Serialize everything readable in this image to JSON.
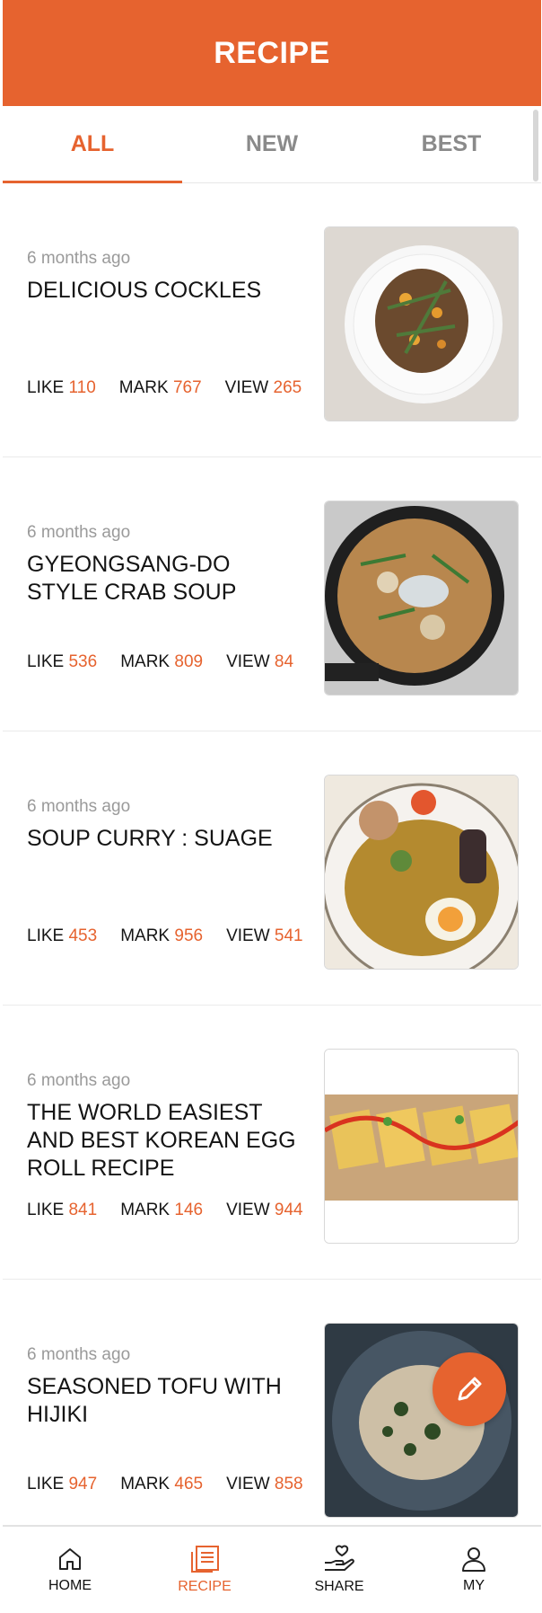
{
  "header": {
    "title": "RECIPE"
  },
  "tabs": [
    {
      "label": "ALL",
      "active": true
    },
    {
      "label": "NEW",
      "active": false
    },
    {
      "label": "BEST",
      "active": false
    }
  ],
  "stat_labels": {
    "like": "LIKE",
    "mark": "MARK",
    "view": "VIEW"
  },
  "recipes": [
    {
      "time": "6 months ago",
      "title": "DELICIOUS COCKLES",
      "like": "110",
      "mark": "767",
      "view": "265",
      "image": "cockles-dish-photo"
    },
    {
      "time": "6 months ago",
      "title": "GYEONGSANG-DO STYLE CRAB SOUP",
      "like": "536",
      "mark": "809",
      "view": "84",
      "image": "crab-soup-photo"
    },
    {
      "time": "6 months ago",
      "title": "SOUP CURRY : SUAGE",
      "like": "453",
      "mark": "956",
      "view": "541",
      "image": "soup-curry-photo"
    },
    {
      "time": "6 months ago",
      "title": "THE WORLD EASIEST AND BEST KOREAN EGG ROLL RECIPE",
      "like": "841",
      "mark": "146",
      "view": "944",
      "image": "egg-roll-photo"
    },
    {
      "time": "6 months ago",
      "title": "SEASONED TOFU WITH HIJIKI",
      "like": "947",
      "mark": "465",
      "view": "858",
      "image": "tofu-hijiki-photo"
    }
  ],
  "bottom_nav": [
    {
      "label": "HOME",
      "icon": "home-icon",
      "active": false
    },
    {
      "label": "RECIPE",
      "icon": "recipe-icon",
      "active": true
    },
    {
      "label": "SHARE",
      "icon": "share-icon",
      "active": false
    },
    {
      "label": "MY",
      "icon": "user-icon",
      "active": false
    }
  ],
  "colors": {
    "accent": "#e6632f",
    "muted": "#9a9a9a",
    "tab_inactive": "#8a8a8a"
  }
}
